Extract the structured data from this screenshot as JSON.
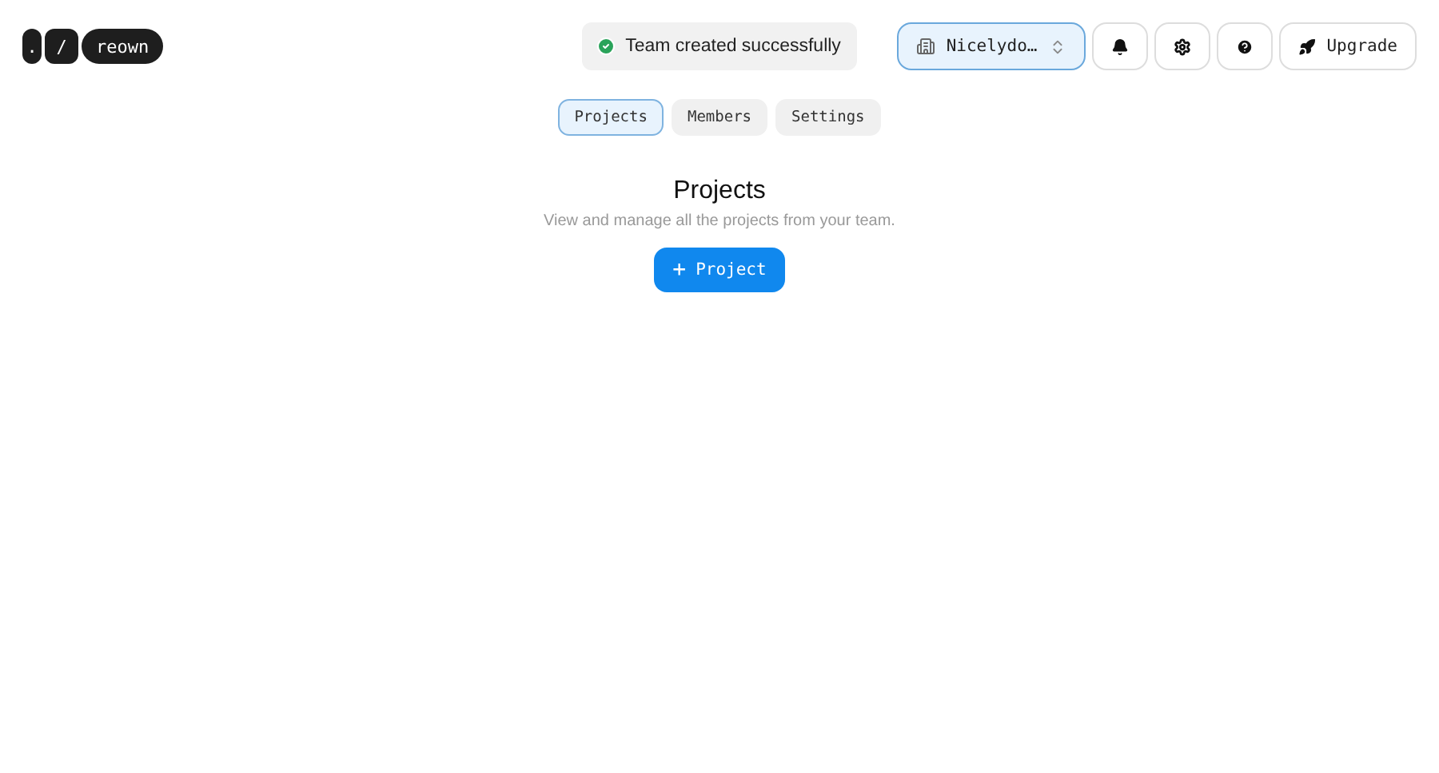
{
  "logo": {
    "keys": [
      ".",
      "/",
      "reown"
    ]
  },
  "toast": {
    "message": "Team created successfully"
  },
  "team_selector": {
    "label": "Nicelydo…"
  },
  "upgrade": {
    "label": "Upgrade"
  },
  "tabs": [
    {
      "label": "Projects",
      "selected": true
    },
    {
      "label": "Members",
      "selected": false
    },
    {
      "label": "Settings",
      "selected": false
    }
  ],
  "section": {
    "title": "Projects",
    "subtitle": "View and manage all the projects from your team.",
    "button": "Project",
    "button_icon": "+"
  }
}
